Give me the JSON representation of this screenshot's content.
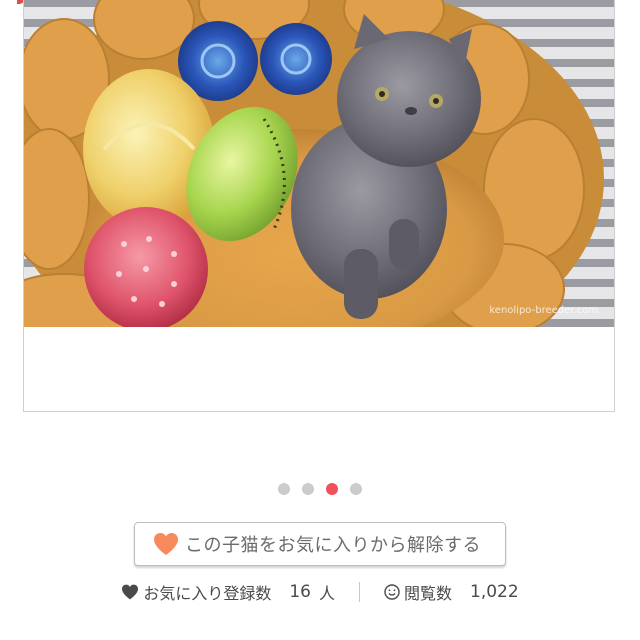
{
  "photo": {
    "alt": "kitten photo",
    "watermark": "kenolipo-breeder.com"
  },
  "carousel": {
    "dot_count": 4,
    "active_index": 2,
    "active_color": "#f0525c",
    "inactive_color": "#cccccc"
  },
  "favorite_button": {
    "label": "この子猫をお気に入りから解除する",
    "icon": "heart-icon",
    "icon_color": "#f78a5a"
  },
  "stats": {
    "favorites_label": "お気に入り登録数",
    "favorites_count": "16",
    "favorites_unit": "人",
    "views_label": "閲覧数",
    "views_count": "1,022"
  }
}
